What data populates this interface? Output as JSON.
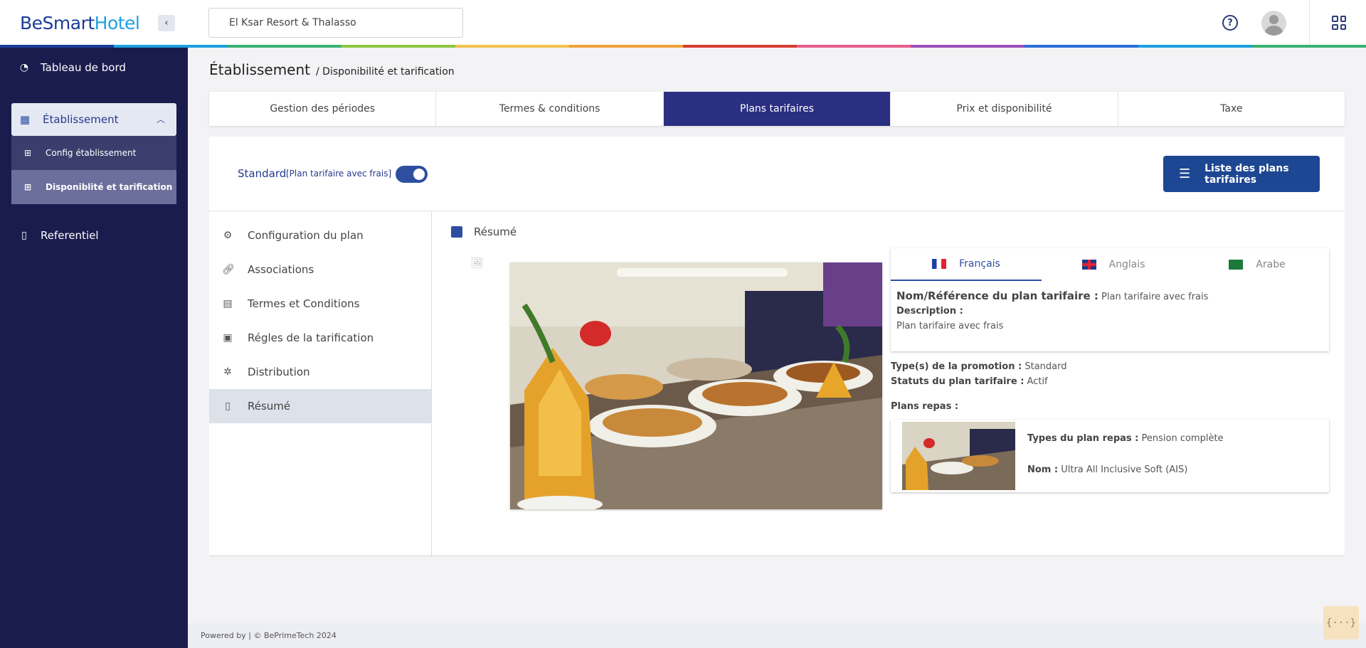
{
  "app": {
    "logo_part1": "BeSmart",
    "logo_part2": "Hotel"
  },
  "header": {
    "hotel_value": "El Ksar Resort & Thalasso",
    "help": "?"
  },
  "colors": {
    "rainbow": [
      "#1b3d9a",
      "#1ea0e0",
      "#3bb273",
      "#8cc63f",
      "#f2c14e",
      "#f0a23b",
      "#d63b2f",
      "#e85d8a",
      "#9b4fb8",
      "#2a6fdb",
      "#1ea0e0",
      "#3bb273"
    ],
    "accent": "#2a2f82",
    "sidebar": "#1a1c4e"
  },
  "sidebar": {
    "dashboard": "Tableau de bord",
    "etablissement": "Établissement",
    "sub_config": "Config établissement",
    "sub_dispo": "Disponiblité et tarification",
    "referentiel": "Referentiel"
  },
  "breadcrumb": {
    "title": "Établissement",
    "sub": "/ Disponibilité et tarification"
  },
  "tabs": [
    "Gestion des périodes",
    "Termes & conditions",
    "Plans tarifaires",
    "Prix et disponibilité",
    "Taxe"
  ],
  "plan": {
    "name": "Standard",
    "sub": "[Plan tarifaire avec frais]",
    "list_button": "Liste des plans tarifaires"
  },
  "left_menu": [
    "Configuration du plan",
    "Associations",
    "Termes et Conditions",
    "Régles de la tarification",
    "Distribution",
    "Résumé"
  ],
  "summary": {
    "title": "Résumé",
    "languages": [
      "Français",
      "Anglais",
      "Arabe"
    ],
    "ref_label": "Nom/Référence du plan tarifaire :",
    "ref_value": "Plan tarifaire avec frais",
    "desc_label": "Description :",
    "desc_value": "Plan tarifaire avec frais",
    "promo_label": "Type(s) de la promotion :",
    "promo_value": "Standard",
    "status_label": "Statuts du plan tarifaire :",
    "status_value": "Actif",
    "meals_label": "Plans repas :",
    "meal_type_label": "Types du plan repas :",
    "meal_type_value": "Pension complète",
    "meal_name_label": "Nom :",
    "meal_name_value": "Ultra All Inclusive Soft (AIS)"
  },
  "footer": "Powered by | © BePrimeTech 2024",
  "json_button": "{···}"
}
